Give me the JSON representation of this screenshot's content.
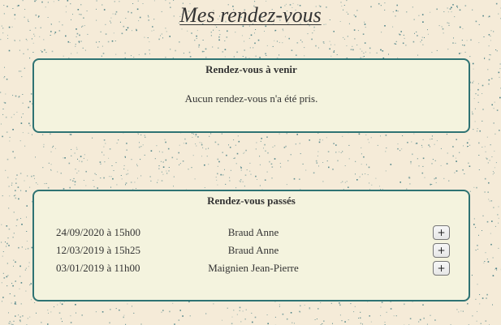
{
  "page": {
    "title": "Mes rendez-vous"
  },
  "colors": {
    "background": "#f5ebd8",
    "speckle": "#2e6f78",
    "panel_fill": "#f4f3de",
    "panel_border": "#2e7373"
  },
  "upcoming": {
    "heading": "Rendez-vous à venir",
    "empty_message": "Aucun rendez-vous n'a été pris."
  },
  "past": {
    "heading": "Rendez-vous passés",
    "appointments": [
      {
        "datetime": "24/09/2020 à 15h00",
        "name": "Braud Anne",
        "action_label": "+"
      },
      {
        "datetime": "12/03/2019 à 15h25",
        "name": "Braud Anne",
        "action_label": "+"
      },
      {
        "datetime": "03/01/2019 à 11h00",
        "name": "Maignien Jean-Pierre",
        "action_label": "+"
      }
    ]
  }
}
